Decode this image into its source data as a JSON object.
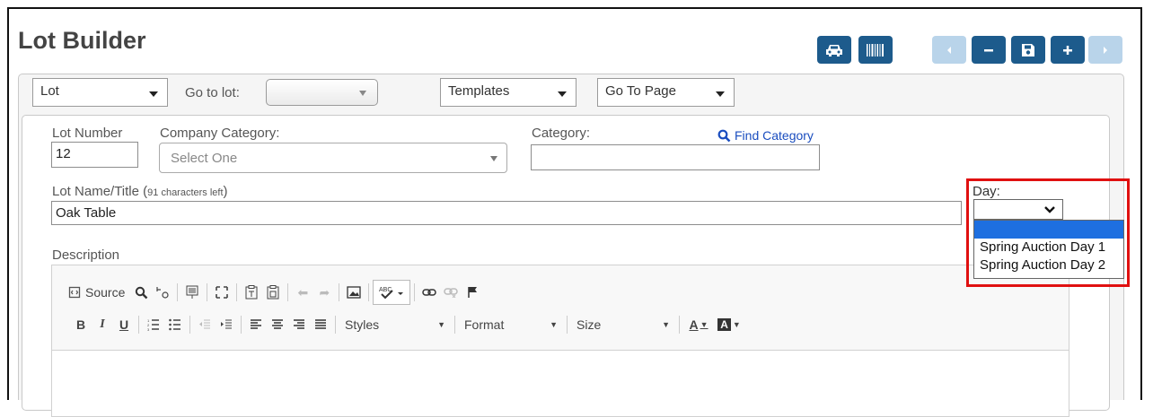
{
  "header": {
    "title": "Lot Builder",
    "buttons": [
      "car-icon",
      "barcode-icon",
      "prev-icon",
      "minus-icon",
      "save-icon",
      "plus-icon",
      "next-icon"
    ]
  },
  "toolbar": {
    "lot_select": "Lot",
    "goto_label": "Go to lot:",
    "goto_value": "",
    "templates_select": "Templates",
    "gotopage_select": "Go To Page"
  },
  "form": {
    "lot_number_label": "Lot Number",
    "lot_number_value": "12",
    "company_category_label": "Company Category:",
    "company_category_placeholder": "Select One",
    "category_label": "Category:",
    "category_value": "",
    "find_category": "Find Category",
    "lot_name_label": "Lot Name/Title (",
    "lot_name_hint": "91 characters left",
    "lot_name_label_end": ")",
    "lot_name_value": "Oak Table",
    "day_label": "Day:",
    "day_value": "",
    "day_options": [
      "",
      "Spring Auction Day 1",
      "Spring Auction Day 2"
    ],
    "description_label": "Description"
  },
  "editor": {
    "source_label": "Source",
    "styles_label": "Styles",
    "format_label": "Format",
    "size_label": "Size"
  },
  "colors": {
    "primary": "#1d5b8c",
    "primary_light": "#b9d4ea",
    "highlight": "#e01010",
    "selected_option": "#1e6fe0",
    "link": "#1a4dbf"
  }
}
